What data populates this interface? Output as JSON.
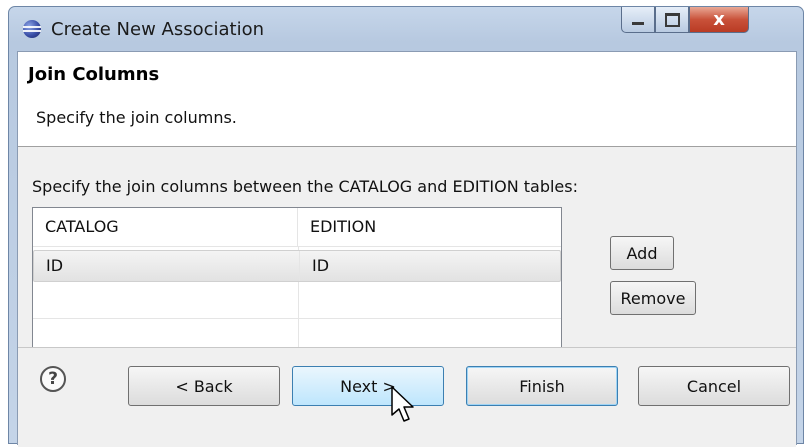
{
  "window": {
    "title": "Create New Association",
    "buttons": {
      "minimize": "",
      "maximize": "",
      "close": "x"
    }
  },
  "header": {
    "title": "Join Columns",
    "description": "Specify the join columns."
  },
  "body": {
    "instruction": "Specify the join columns between the CATALOG and EDITION tables:",
    "table": {
      "columns": [
        "CATALOG",
        "EDITION"
      ],
      "rows": [
        [
          "ID",
          "ID"
        ],
        [
          "",
          ""
        ],
        [
          "",
          ""
        ]
      ]
    },
    "add_label": "Add",
    "remove_label": "Remove"
  },
  "footer": {
    "help_glyph": "?",
    "back_label": "< Back",
    "next_label": "Next >",
    "finish_label": "Finish",
    "cancel_label": "Cancel"
  }
}
